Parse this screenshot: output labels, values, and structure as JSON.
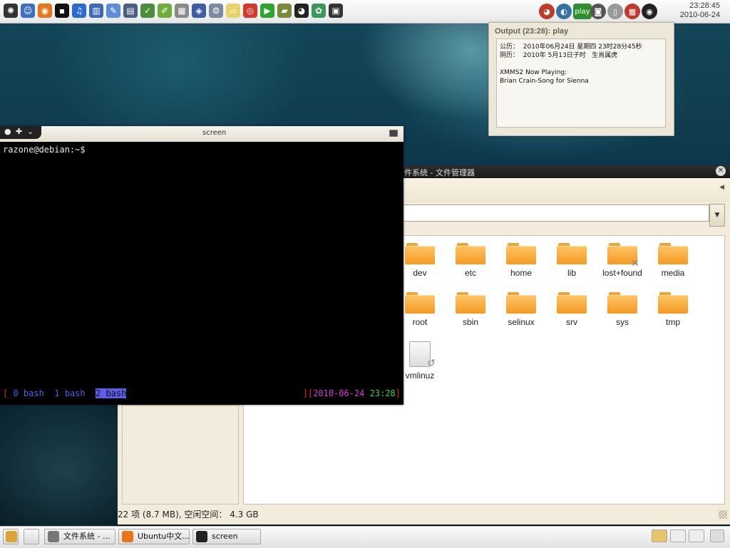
{
  "top_panel": {
    "launchers": [
      {
        "name": "debian-menu-icon",
        "glyph": "✺",
        "color": "#333333"
      },
      {
        "name": "finder-icon",
        "glyph": "☺",
        "color": "#3b6fc9"
      },
      {
        "name": "firefox-icon",
        "glyph": "◉",
        "color": "#e8751a"
      },
      {
        "name": "terminal-icon",
        "glyph": "▪",
        "color": "#111111"
      },
      {
        "name": "music-icon",
        "glyph": "♫",
        "color": "#2a6bd6"
      },
      {
        "name": "books-icon",
        "glyph": "▥",
        "color": "#3a6ab8"
      },
      {
        "name": "editor-icon",
        "glyph": "✎",
        "color": "#5b8ed6"
      },
      {
        "name": "scanner-icon",
        "glyph": "▤",
        "color": "#4a5f85"
      },
      {
        "name": "settings-icon",
        "glyph": "✓",
        "color": "#4c8c3a"
      },
      {
        "name": "notes-icon",
        "glyph": "✐",
        "color": "#6dae3a"
      },
      {
        "name": "calculator-icon",
        "glyph": "▦",
        "color": "#8a8a8a"
      },
      {
        "name": "virtualbox-icon",
        "glyph": "◈",
        "color": "#3a5fa8"
      },
      {
        "name": "tools-icon",
        "glyph": "⚙",
        "color": "#7b8a9e"
      },
      {
        "name": "sticky-note-icon",
        "glyph": "▱",
        "color": "#e8d36a"
      },
      {
        "name": "chrome-icon",
        "glyph": "◎",
        "color": "#d9362b"
      },
      {
        "name": "play-icon",
        "glyph": "▶",
        "color": "#2aa62a"
      },
      {
        "name": "dictionary-icon",
        "glyph": "▰",
        "color": "#7a8a3a"
      },
      {
        "name": "qq-icon",
        "glyph": "◕",
        "color": "#222222"
      },
      {
        "name": "messenger-icon",
        "glyph": "✿",
        "color": "#3a9a5a"
      },
      {
        "name": "remote-icon",
        "glyph": "▣",
        "color": "#333333"
      }
    ],
    "tray": [
      {
        "name": "qq-tray-icon",
        "glyph": "◕",
        "color": "#c0392b"
      },
      {
        "name": "python-tray-icon",
        "glyph": "◐",
        "color": "#3572a5"
      },
      {
        "name": "xmms2-play-icon",
        "glyph": "✓",
        "color": "#2f8f2f",
        "label": "play"
      },
      {
        "name": "camera-icon",
        "glyph": "◙",
        "color": "#555555"
      },
      {
        "name": "trash-tray-icon",
        "glyph": "▯",
        "color": "#9a9a9a"
      },
      {
        "name": "network-icon",
        "glyph": "▩",
        "color": "#c0392b"
      },
      {
        "name": "volume-icon",
        "glyph": "◉",
        "color": "#222222"
      }
    ],
    "clock_time": "23:28:45",
    "clock_date": "2010-06-24"
  },
  "notification": {
    "title": "Output (23:28): play",
    "gregorian_label": "公历：",
    "gregorian_value": "2010年06月24日 星期四 23时28分45秒",
    "lunar_label": "阴历：",
    "lunar_value": "2010年 5月13日子时   生肖属虎",
    "np_label": "XMMS2 Now Playing:",
    "np_track": "Brian Crain-Song for Sienna"
  },
  "file_manager": {
    "title": "件系统 - 文件管理器",
    "status": "22 项 (8.7 MB), 空闲空间： 4.3 GB",
    "items": [
      {
        "label": "dev",
        "kind": "folder"
      },
      {
        "label": "etc",
        "kind": "folder"
      },
      {
        "label": "home",
        "kind": "folder"
      },
      {
        "label": "lib",
        "kind": "folder"
      },
      {
        "label": "lost+found",
        "kind": "folder-locked"
      },
      {
        "label": "media",
        "kind": "folder"
      },
      {
        "label": "root",
        "kind": "folder"
      },
      {
        "label": "sbin",
        "kind": "folder"
      },
      {
        "label": "selinux",
        "kind": "folder"
      },
      {
        "label": "srv",
        "kind": "folder"
      },
      {
        "label": "sys",
        "kind": "folder"
      },
      {
        "label": "tmp",
        "kind": "folder"
      },
      {
        "label": "vmlinuz",
        "kind": "file-link"
      }
    ]
  },
  "terminal": {
    "title": "screen",
    "prompt": "razone@debian:~$",
    "status_open": "[ ",
    "windows": [
      {
        "label": "0 bash",
        "active": false
      },
      {
        "label": "1 bash",
        "active": false
      },
      {
        "label": "2 bash",
        "active": true
      }
    ],
    "status_close": "][",
    "date": "2010-06-24",
    "time": "23:28",
    "status_end": "]"
  },
  "bottom_panel": {
    "tasks": [
      {
        "label": "文件系统 - ...",
        "icon": "file-manager-task-icon",
        "color": "#777777"
      },
      {
        "label": "Ubuntu中文...",
        "icon": "firefox-task-icon",
        "color": "#e8751a"
      },
      {
        "label": "screen",
        "icon": "terminal-task-icon",
        "color": "#222222"
      }
    ]
  }
}
